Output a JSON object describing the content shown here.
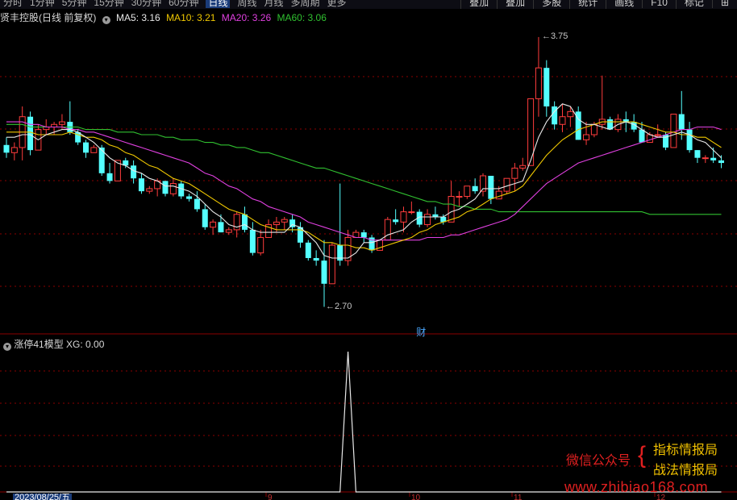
{
  "toolbar": {
    "period_tabs": [
      "分时",
      "1分钟",
      "5分钟",
      "15分钟",
      "30分钟",
      "60分钟",
      "日线",
      "周线",
      "月线",
      "多周期",
      "更多"
    ],
    "active_tab": "日线",
    "right_buttons": [
      "叠加",
      "叠加",
      "多股",
      "统计",
      "画线",
      "F10",
      "标记",
      "⊞"
    ]
  },
  "main_legend": {
    "stock": "贤丰控股(日线 前复权)",
    "ma5": "MA5: 3.16",
    "ma10": "MA10: 3.21",
    "ma20": "MA20: 3.26",
    "ma60": "MA60: 3.06"
  },
  "indicator_legend": {
    "name": "涨停41模型",
    "xg": "XG: 0.00"
  },
  "labels": {
    "high": "3.75",
    "low": "2.70",
    "finance_marker": "财",
    "date": "2023/08/25/五",
    "x_ticks": [
      "9",
      "10",
      "11",
      "12"
    ]
  },
  "watermark": {
    "wechat": "微信公众号",
    "brand1": "指标情报局",
    "brand2": "战法情报局",
    "url": "www.zhibiao168.com"
  },
  "colors": {
    "up": "#ff3c3c",
    "down": "#54ffff",
    "ma5": "#e8e8e8",
    "ma10": "#f0c800",
    "ma20": "#e040e0",
    "ma60": "#30c030",
    "xg_line": "#e8e8e8",
    "grid": "#8b0000"
  },
  "chart_data": {
    "type": "candlestick",
    "ylim": [
      2.62,
      3.8
    ],
    "candles": [
      [
        3.33,
        3.36,
        3.28,
        3.3
      ],
      [
        3.3,
        3.34,
        3.27,
        3.32
      ],
      [
        3.32,
        3.48,
        3.27,
        3.44
      ],
      [
        3.44,
        3.46,
        3.29,
        3.31
      ],
      [
        3.31,
        3.41,
        3.31,
        3.39
      ],
      [
        3.39,
        3.43,
        3.37,
        3.4
      ],
      [
        3.4,
        3.42,
        3.37,
        3.41
      ],
      [
        3.41,
        3.45,
        3.39,
        3.42
      ],
      [
        3.42,
        3.5,
        3.37,
        3.38
      ],
      [
        3.38,
        3.39,
        3.33,
        3.34
      ],
      [
        3.34,
        3.35,
        3.28,
        3.3
      ],
      [
        3.3,
        3.33,
        3.3,
        3.32
      ],
      [
        3.32,
        3.33,
        3.21,
        3.22
      ],
      [
        3.22,
        3.26,
        3.18,
        3.19
      ],
      [
        3.19,
        3.27,
        3.19,
        3.27
      ],
      [
        3.27,
        3.28,
        3.24,
        3.25
      ],
      [
        3.25,
        3.27,
        3.18,
        3.2
      ],
      [
        3.2,
        3.22,
        3.14,
        3.15
      ],
      [
        3.15,
        3.17,
        3.14,
        3.16
      ],
      [
        3.16,
        3.2,
        3.13,
        3.19
      ],
      [
        3.19,
        3.19,
        3.13,
        3.14
      ],
      [
        3.14,
        3.2,
        3.13,
        3.18
      ],
      [
        3.18,
        3.19,
        3.12,
        3.13
      ],
      [
        3.13,
        3.14,
        3.11,
        3.12
      ],
      [
        3.12,
        3.15,
        3.07,
        3.08
      ],
      [
        3.08,
        3.1,
        3.0,
        3.01
      ],
      [
        3.01,
        3.04,
        2.98,
        3.03
      ],
      [
        3.03,
        3.06,
        2.99,
        2.99
      ],
      [
        2.99,
        3.01,
        2.98,
        3.0
      ],
      [
        3.0,
        3.07,
        2.97,
        3.06
      ],
      [
        3.06,
        3.09,
        2.99,
        3.0
      ],
      [
        3.0,
        3.03,
        2.9,
        2.91
      ],
      [
        2.91,
        3.0,
        2.9,
        2.97
      ],
      [
        2.97,
        3.04,
        2.97,
        3.02
      ],
      [
        3.02,
        3.05,
        2.99,
        3.03
      ],
      [
        3.03,
        3.05,
        3.0,
        3.04
      ],
      [
        3.04,
        3.06,
        2.99,
        3.01
      ],
      [
        3.01,
        3.03,
        2.93,
        2.95
      ],
      [
        2.95,
        2.96,
        2.88,
        2.89
      ],
      [
        2.89,
        2.92,
        2.86,
        2.88
      ],
      [
        2.88,
        2.96,
        2.7,
        2.79
      ],
      [
        2.79,
        2.95,
        2.79,
        2.94
      ],
      [
        2.94,
        3.18,
        2.86,
        2.88
      ],
      [
        2.88,
        3.0,
        2.86,
        2.97
      ],
      [
        2.97,
        3.0,
        2.97,
        2.99
      ],
      [
        2.99,
        3.0,
        2.95,
        2.97
      ],
      [
        2.97,
        2.98,
        2.91,
        2.92
      ],
      [
        2.92,
        2.96,
        2.92,
        2.96
      ],
      [
        2.96,
        3.05,
        2.96,
        3.04
      ],
      [
        3.04,
        3.08,
        3.02,
        3.03
      ],
      [
        3.03,
        3.09,
        2.99,
        3.07
      ],
      [
        3.07,
        3.11,
        3.06,
        3.07
      ],
      [
        3.07,
        3.08,
        3.01,
        3.02
      ],
      [
        3.02,
        3.08,
        3.01,
        3.06
      ],
      [
        3.06,
        3.09,
        3.04,
        3.05
      ],
      [
        3.05,
        3.06,
        3.02,
        3.03
      ],
      [
        3.03,
        3.19,
        3.03,
        3.13
      ],
      [
        3.13,
        3.15,
        3.09,
        3.13
      ],
      [
        3.13,
        3.17,
        3.12,
        3.17
      ],
      [
        3.17,
        3.2,
        3.14,
        3.15
      ],
      [
        3.15,
        3.22,
        3.13,
        3.21
      ],
      [
        3.21,
        3.21,
        3.1,
        3.12
      ],
      [
        3.12,
        3.17,
        3.12,
        3.15
      ],
      [
        3.15,
        3.2,
        3.14,
        3.2
      ],
      [
        3.2,
        3.26,
        3.15,
        3.24
      ],
      [
        3.24,
        3.28,
        3.23,
        3.25
      ],
      [
        3.25,
        3.51,
        3.25,
        3.51
      ],
      [
        3.51,
        3.75,
        3.44,
        3.63
      ],
      [
        3.63,
        3.66,
        3.44,
        3.48
      ],
      [
        3.48,
        3.5,
        3.39,
        3.41
      ],
      [
        3.41,
        3.49,
        3.38,
        3.44
      ],
      [
        3.44,
        3.48,
        3.4,
        3.46
      ],
      [
        3.46,
        3.48,
        3.35,
        3.35
      ],
      [
        3.35,
        3.42,
        3.33,
        3.37
      ],
      [
        3.37,
        3.42,
        3.36,
        3.41
      ],
      [
        3.41,
        3.6,
        3.39,
        3.43
      ],
      [
        3.43,
        3.44,
        3.39,
        3.39
      ],
      [
        3.39,
        3.45,
        3.38,
        3.43
      ],
      [
        3.43,
        3.46,
        3.38,
        3.42
      ],
      [
        3.42,
        3.45,
        3.38,
        3.39
      ],
      [
        3.39,
        3.42,
        3.34,
        3.34
      ],
      [
        3.34,
        3.38,
        3.34,
        3.37
      ],
      [
        3.37,
        3.41,
        3.36,
        3.37
      ],
      [
        3.37,
        3.38,
        3.31,
        3.32
      ],
      [
        3.32,
        3.45,
        3.32,
        3.45
      ],
      [
        3.45,
        3.54,
        3.35,
        3.39
      ],
      [
        3.39,
        3.42,
        3.3,
        3.31
      ],
      [
        3.31,
        3.31,
        3.26,
        3.28
      ],
      [
        3.28,
        3.29,
        3.26,
        3.28
      ],
      [
        3.28,
        3.32,
        3.26,
        3.27
      ],
      [
        3.27,
        3.29,
        3.24,
        3.26
      ]
    ],
    "ma5": [
      3.36,
      3.36,
      3.37,
      3.37,
      3.35,
      3.37,
      3.38,
      3.39,
      3.39,
      3.38,
      3.36,
      3.34,
      3.31,
      3.28,
      3.26,
      3.25,
      3.23,
      3.22,
      3.2,
      3.19,
      3.17,
      3.17,
      3.16,
      3.15,
      3.13,
      3.1,
      3.07,
      3.05,
      3.02,
      3.01,
      3.02,
      3.0,
      2.99,
      2.99,
      2.99,
      2.99,
      3.02,
      3.01,
      2.98,
      2.95,
      2.9,
      2.89,
      2.89,
      2.89,
      2.91,
      2.95,
      2.95,
      2.96,
      2.98,
      2.99,
      3.0,
      3.03,
      3.05,
      3.05,
      3.05,
      3.05,
      3.07,
      3.08,
      3.1,
      3.12,
      3.16,
      3.16,
      3.16,
      3.17,
      3.18,
      3.19,
      3.27,
      3.36,
      3.42,
      3.46,
      3.49,
      3.48,
      3.43,
      3.41,
      3.41,
      3.4,
      3.39,
      3.41,
      3.42,
      3.41,
      3.39,
      3.37,
      3.36,
      3.36,
      3.37,
      3.38,
      3.37,
      3.35,
      3.34,
      3.31,
      3.28
    ],
    "ma10": [
      3.38,
      3.38,
      3.38,
      3.38,
      3.37,
      3.37,
      3.37,
      3.37,
      3.38,
      3.37,
      3.36,
      3.36,
      3.35,
      3.33,
      3.32,
      3.3,
      3.29,
      3.27,
      3.25,
      3.24,
      3.22,
      3.2,
      3.19,
      3.18,
      3.16,
      3.14,
      3.12,
      3.1,
      3.08,
      3.07,
      3.06,
      3.04,
      3.02,
      3.01,
      3.0,
      3.0,
      3.0,
      3.0,
      2.99,
      2.97,
      2.95,
      2.95,
      2.94,
      2.94,
      2.93,
      2.93,
      2.92,
      2.93,
      2.94,
      2.95,
      2.96,
      2.97,
      2.99,
      3.0,
      3.02,
      3.03,
      3.04,
      3.05,
      3.07,
      3.08,
      3.1,
      3.12,
      3.13,
      3.14,
      3.15,
      3.17,
      3.21,
      3.25,
      3.29,
      3.32,
      3.35,
      3.37,
      3.39,
      3.4,
      3.41,
      3.42,
      3.42,
      3.42,
      3.42,
      3.42,
      3.41,
      3.4,
      3.39,
      3.38,
      3.38,
      3.37,
      3.37,
      3.36,
      3.36,
      3.34,
      3.32
    ],
    "ma20": [
      3.42,
      3.42,
      3.42,
      3.41,
      3.41,
      3.4,
      3.4,
      3.4,
      3.39,
      3.39,
      3.38,
      3.38,
      3.37,
      3.36,
      3.35,
      3.34,
      3.33,
      3.32,
      3.31,
      3.3,
      3.29,
      3.28,
      3.27,
      3.26,
      3.24,
      3.22,
      3.21,
      3.19,
      3.17,
      3.16,
      3.14,
      3.12,
      3.11,
      3.09,
      3.08,
      3.07,
      3.06,
      3.05,
      3.03,
      3.02,
      3.01,
      3.0,
      2.99,
      2.98,
      2.97,
      2.97,
      2.96,
      2.96,
      2.96,
      2.96,
      2.96,
      2.96,
      2.96,
      2.97,
      2.97,
      2.97,
      2.98,
      2.98,
      2.99,
      3.0,
      3.01,
      3.02,
      3.03,
      3.04,
      3.06,
      3.09,
      3.12,
      3.15,
      3.18,
      3.2,
      3.22,
      3.24,
      3.26,
      3.27,
      3.28,
      3.29,
      3.3,
      3.31,
      3.32,
      3.33,
      3.34,
      3.35,
      3.36,
      3.37,
      3.38,
      3.39,
      3.39,
      3.4,
      3.4,
      3.4,
      3.39
    ],
    "ma60": [
      3.41,
      3.41,
      3.41,
      3.4,
      3.4,
      3.4,
      3.4,
      3.4,
      3.4,
      3.4,
      3.39,
      3.39,
      3.39,
      3.39,
      3.38,
      3.38,
      3.38,
      3.37,
      3.37,
      3.37,
      3.36,
      3.36,
      3.35,
      3.35,
      3.35,
      3.34,
      3.34,
      3.33,
      3.33,
      3.32,
      3.32,
      3.31,
      3.3,
      3.3,
      3.29,
      3.28,
      3.27,
      3.26,
      3.25,
      3.24,
      3.24,
      3.23,
      3.22,
      3.21,
      3.2,
      3.19,
      3.18,
      3.17,
      3.16,
      3.15,
      3.14,
      3.13,
      3.12,
      3.11,
      3.11,
      3.1,
      3.1,
      3.09,
      3.09,
      3.08,
      3.08,
      3.08,
      3.07,
      3.07,
      3.07,
      3.07,
      3.07,
      3.07,
      3.07,
      3.07,
      3.07,
      3.07,
      3.07,
      3.07,
      3.07,
      3.07,
      3.07,
      3.07,
      3.07,
      3.07,
      3.07,
      3.06,
      3.06,
      3.06,
      3.06,
      3.06,
      3.06,
      3.06,
      3.06,
      3.06,
      3.06
    ],
    "xg": [
      0,
      0,
      0,
      0,
      0,
      0,
      0,
      0,
      0,
      0,
      0,
      0,
      0,
      0,
      0,
      0,
      0,
      0,
      0,
      0,
      0,
      0,
      0,
      0,
      0,
      0,
      0,
      0,
      0,
      0,
      0,
      0,
      0,
      0,
      0,
      0,
      0,
      0,
      0,
      0,
      0,
      0,
      0,
      1,
      0,
      0,
      0,
      0,
      0,
      0,
      0,
      0,
      0,
      0,
      0,
      0,
      0,
      0,
      0,
      0,
      0,
      0,
      0,
      0,
      0,
      0,
      0,
      0,
      0,
      0,
      0,
      0,
      0,
      0,
      0,
      0,
      0,
      0,
      0,
      0,
      0,
      0,
      0,
      0,
      0,
      0,
      0,
      0,
      0,
      0,
      0
    ]
  }
}
